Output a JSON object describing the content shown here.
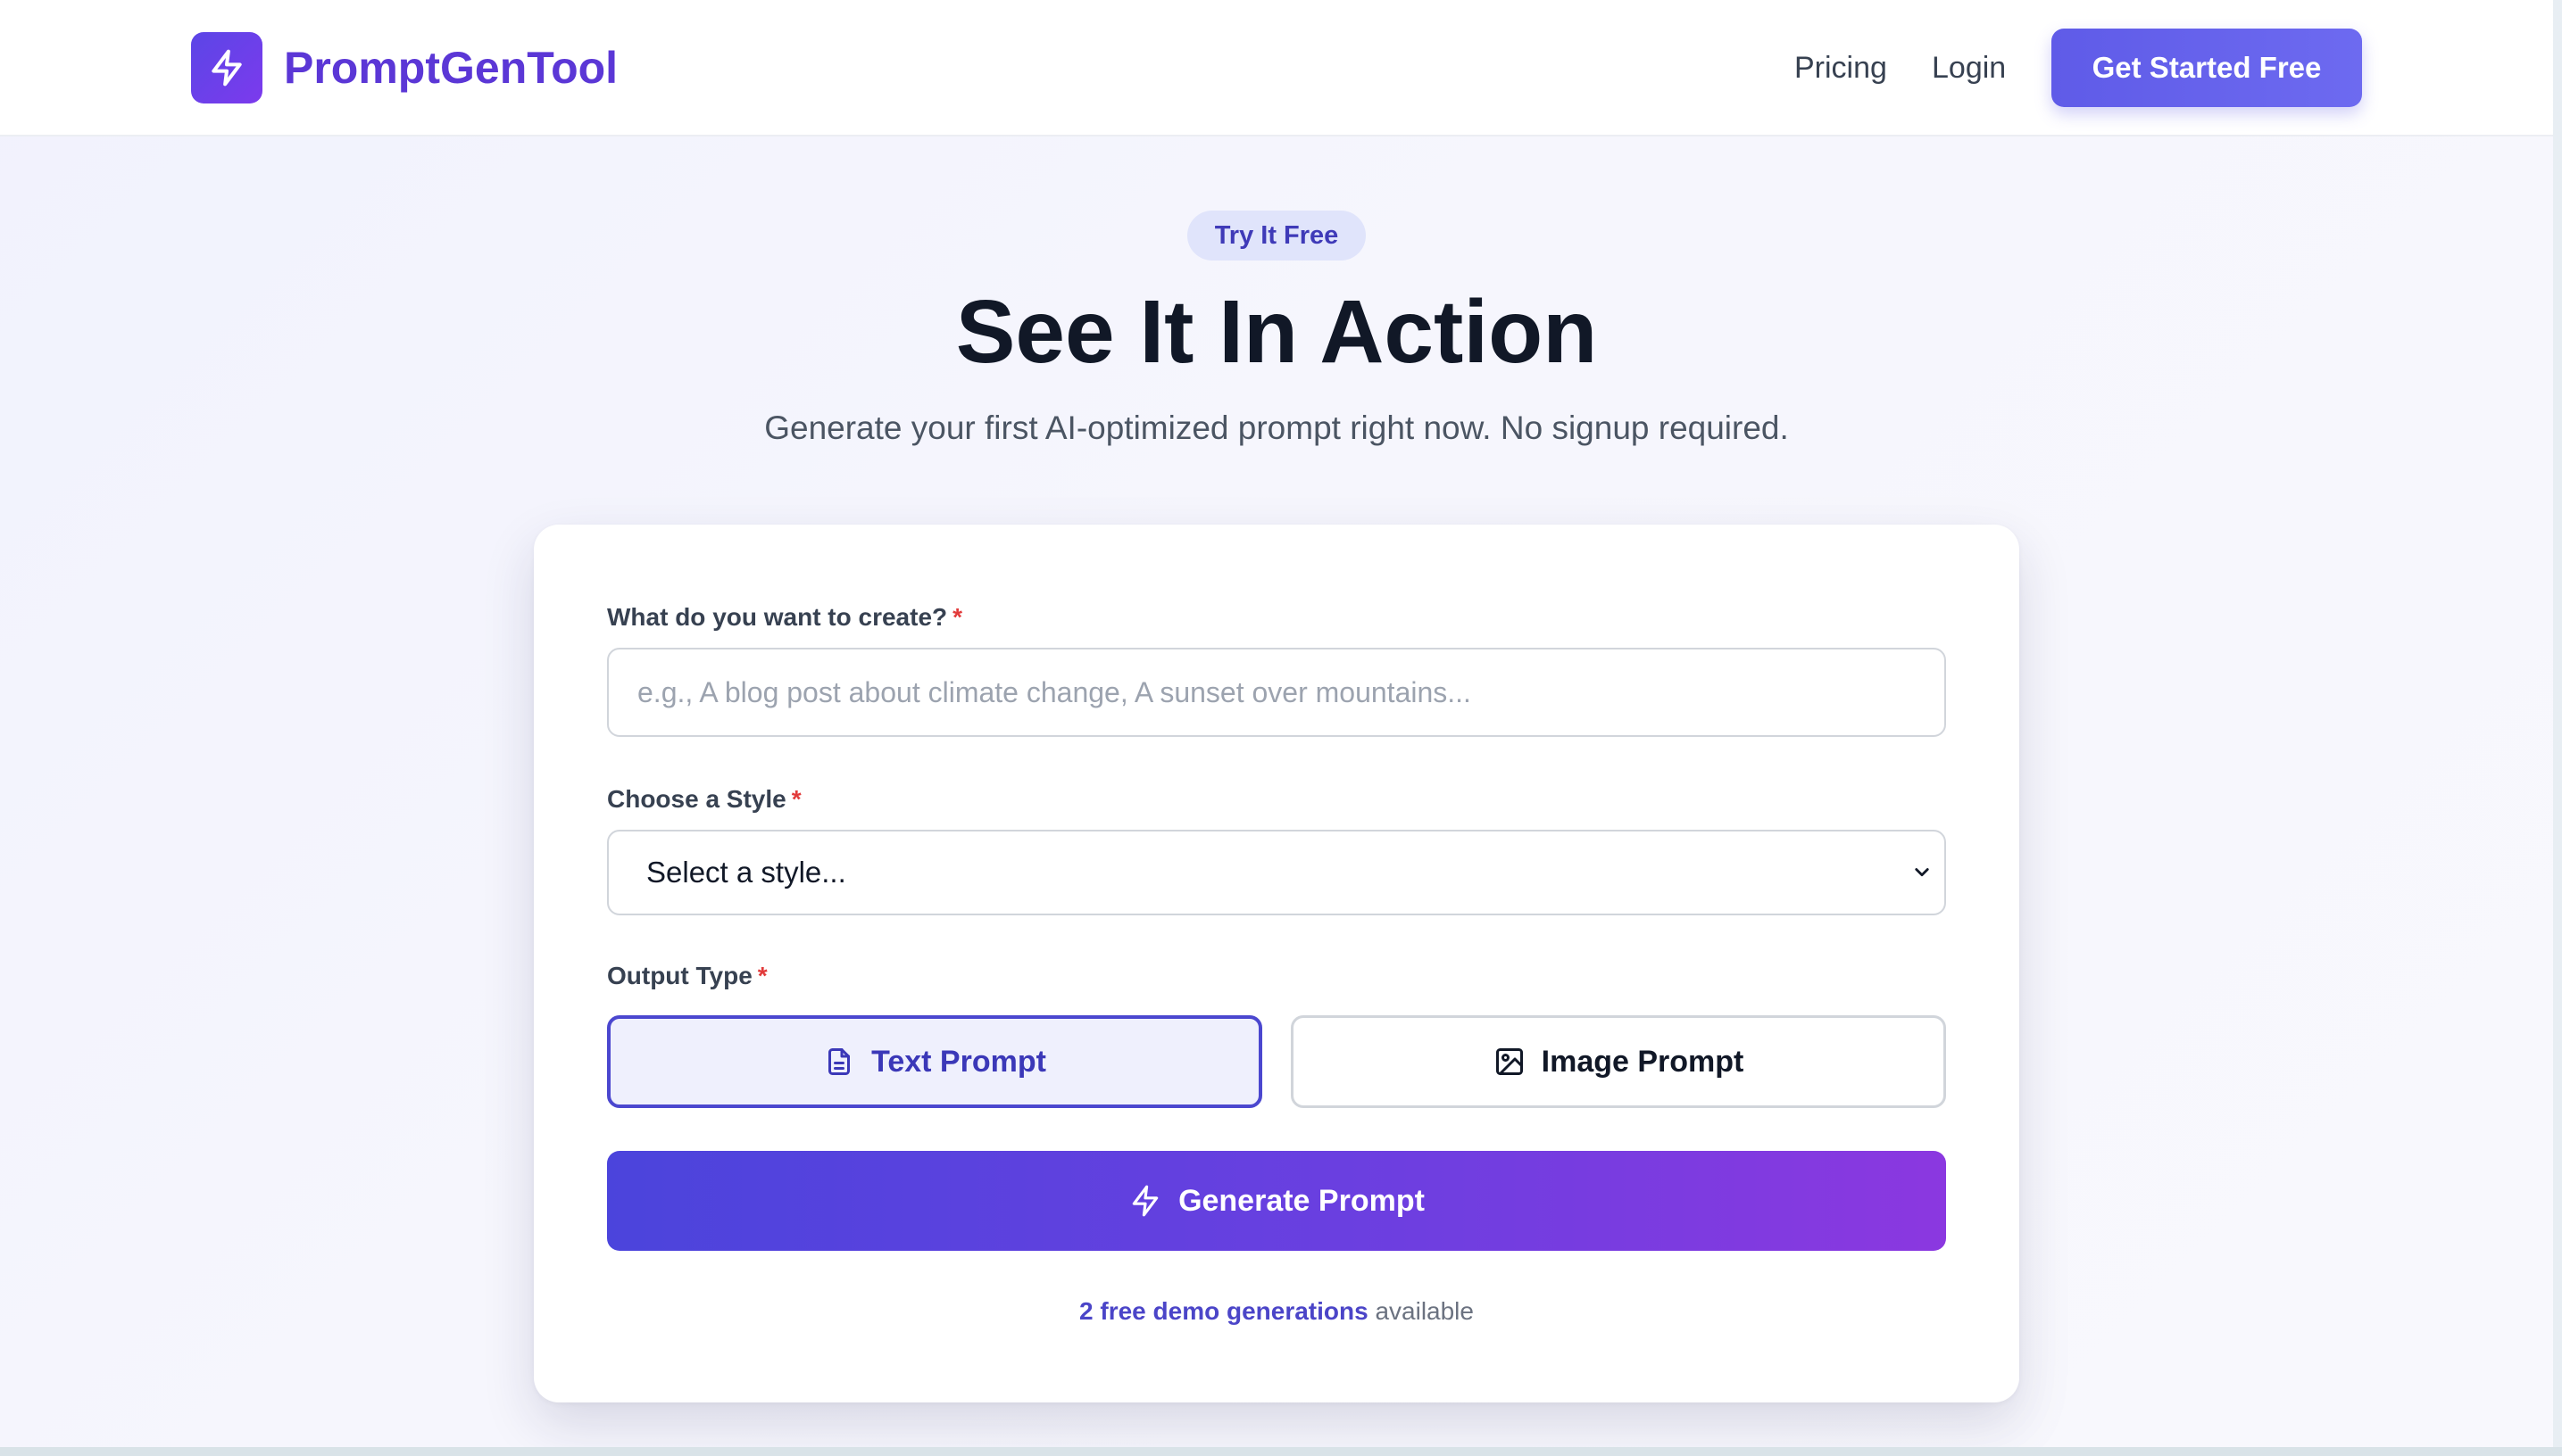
{
  "header": {
    "brand": "PromptGenTool",
    "logo_icon": "lightning-bolt-icon",
    "nav": {
      "pricing": "Pricing",
      "login": "Login"
    },
    "cta": "Get Started Free"
  },
  "hero": {
    "badge": "Try It Free",
    "title": "See It In Action",
    "subtitle": "Generate your first AI-optimized prompt right now. No signup required."
  },
  "form": {
    "create_label": "What do you want to create?",
    "create_placeholder": "e.g., A blog post about climate change, A sunset over mountains...",
    "create_value": "",
    "style_label": "Choose a Style",
    "style_selected": "Select a style...",
    "output_label": "Output Type",
    "required_mark": "*",
    "output_options": [
      {
        "label": "Text Prompt",
        "icon": "document-icon",
        "selected": true
      },
      {
        "label": "Image Prompt",
        "icon": "image-icon",
        "selected": false
      }
    ],
    "generate_label": "Generate Prompt",
    "demo_highlight": "2 free demo generations",
    "demo_suffix": " available"
  },
  "colors": {
    "brand": "#5b37d6",
    "accent": "#4b47cf",
    "required": "#e23b3b"
  }
}
